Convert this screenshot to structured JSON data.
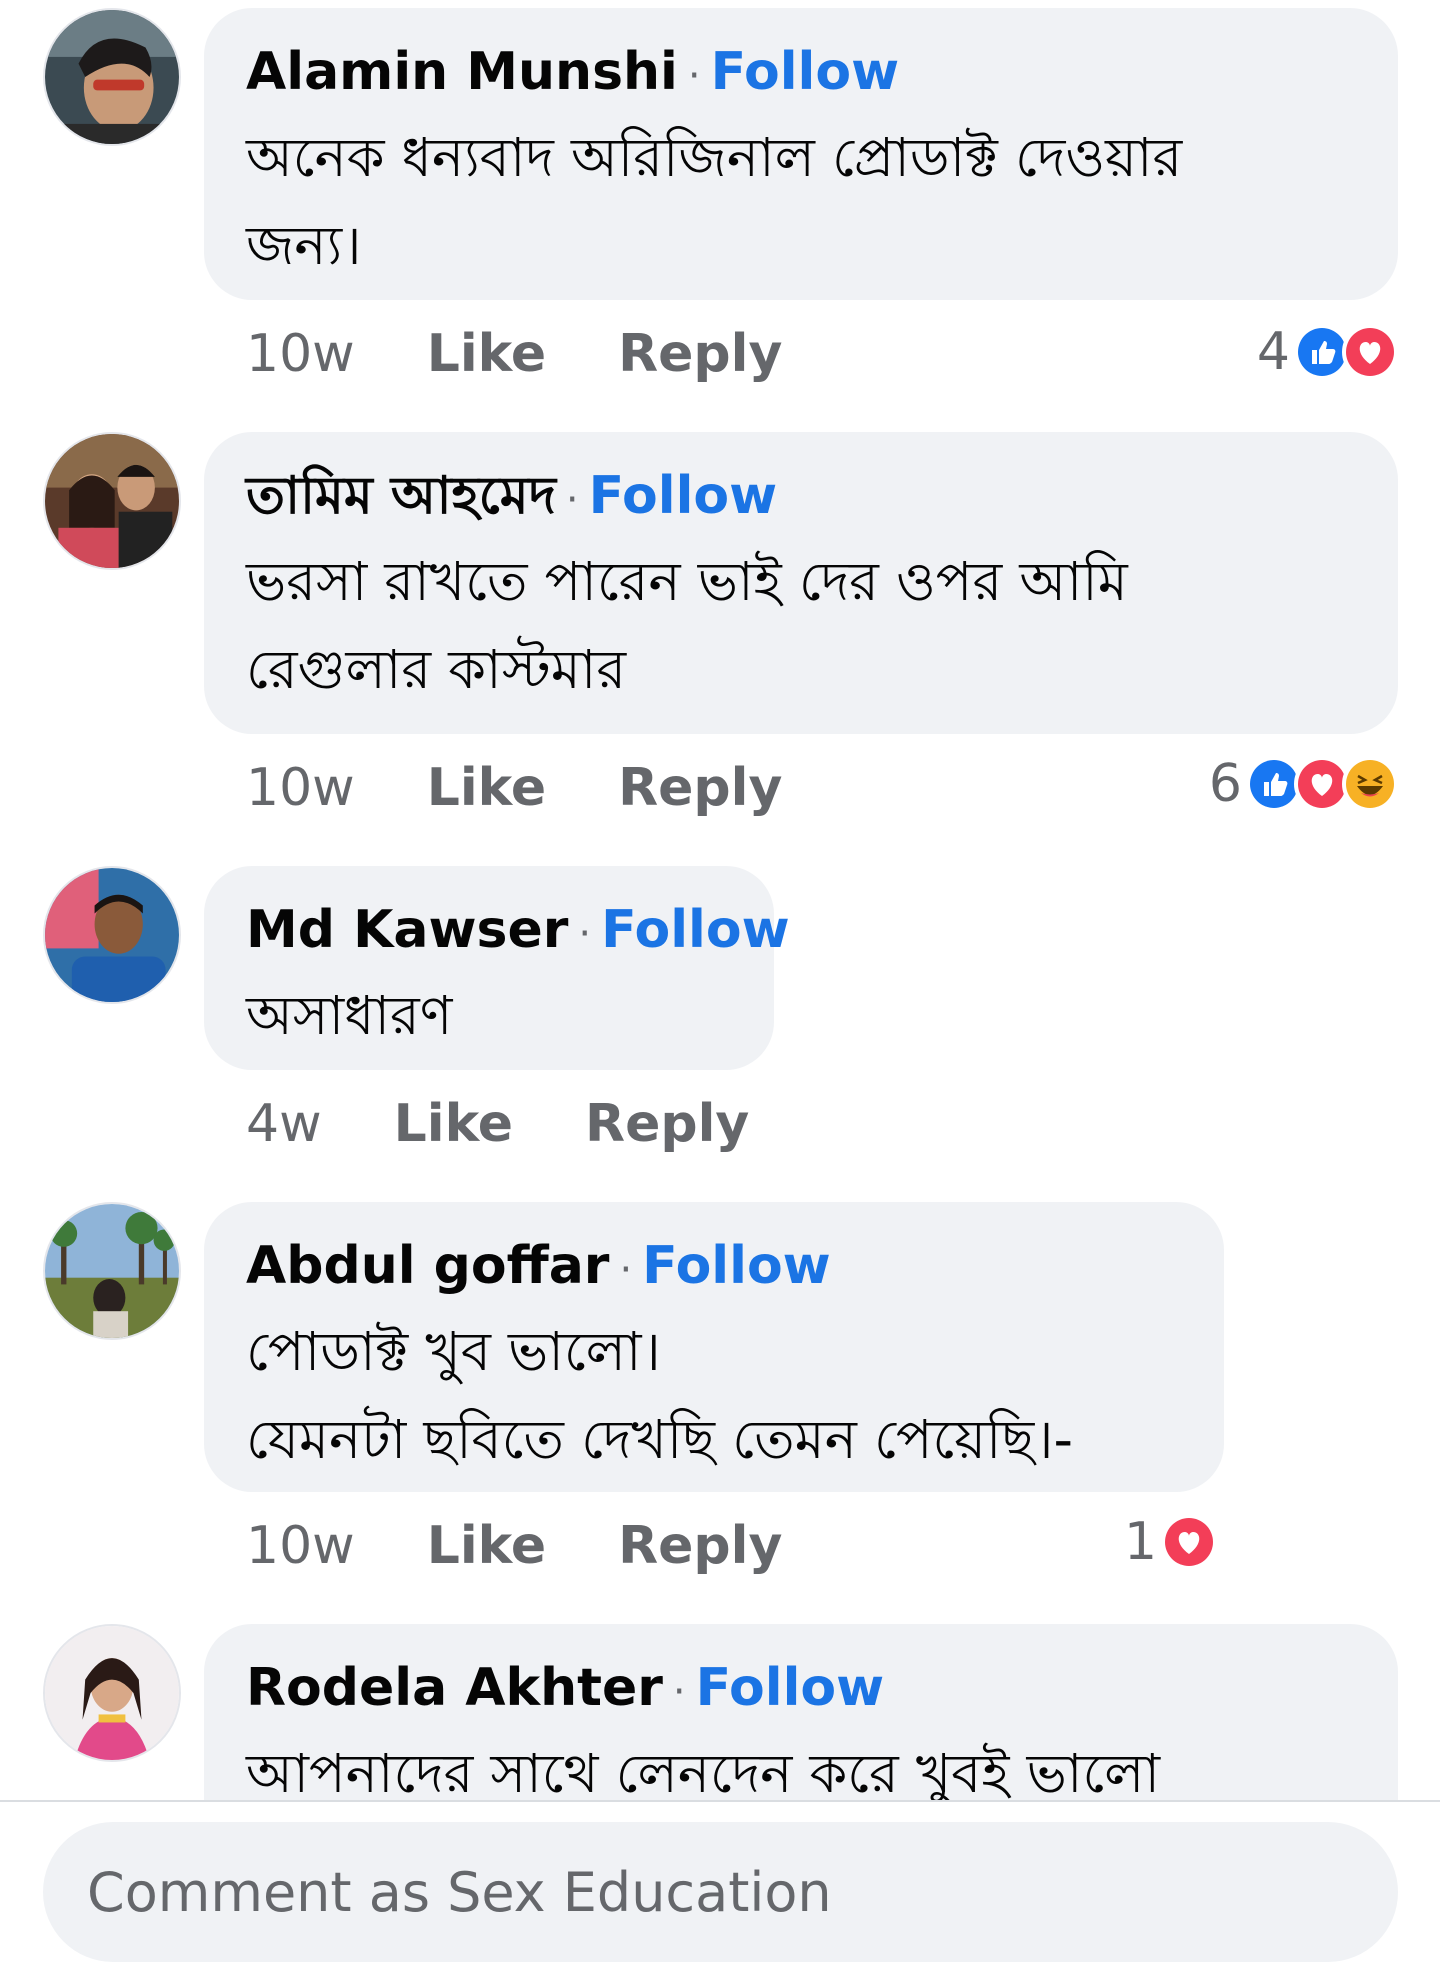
{
  "comments": [
    {
      "author": "Alamin Munshi",
      "follow_label": "Follow",
      "separator": "·",
      "text": "অনেক ধন্যবাদ অরিজিনাল প্রোডাক্ট দেওয়ার\nজন্য।",
      "time": "10w",
      "like_label": "Like",
      "reply_label": "Reply",
      "reaction_count": "4",
      "reactions": [
        "like",
        "love"
      ]
    },
    {
      "author": "তামিম আহমেদ",
      "follow_label": "Follow",
      "separator": "·",
      "text": "ভরসা রাখতে পারেন ভাই দের ওপর আমি\nরেগুলার কাস্টমার",
      "time": "10w",
      "like_label": "Like",
      "reply_label": "Reply",
      "reaction_count": "6",
      "reactions": [
        "like",
        "love",
        "haha"
      ]
    },
    {
      "author": "Md Kawser",
      "follow_label": "Follow",
      "separator": "·",
      "text": "অসাধারণ",
      "time": "4w",
      "like_label": "Like",
      "reply_label": "Reply"
    },
    {
      "author": "Abdul goffar",
      "follow_label": "Follow",
      "separator": "·",
      "text": "পোডাক্ট খুব ভালো।\nযেমনটা ছবিতে দেখছি তেমন পেয়েছি।-",
      "time": "10w",
      "like_label": "Like",
      "reply_label": "Reply",
      "reaction_count": "1",
      "reactions": [
        "love"
      ]
    },
    {
      "author": "Rodela Akhter",
      "follow_label": "Follow",
      "separator": "·",
      "text": "আপনাদের সাথে লেনদেন করে খুবই ভালো"
    }
  ],
  "composer": {
    "placeholder": "Comment as Sex Education"
  },
  "colors": {
    "link": "#1b74e4",
    "bubble": "#f0f2f5",
    "muted": "#65676b",
    "like": "#1877f2",
    "love": "#f33e58",
    "haha": "#f7b125"
  },
  "icons": {
    "like": "thumbs-up-icon",
    "love": "heart-icon",
    "haha": "laughing-face-icon"
  }
}
